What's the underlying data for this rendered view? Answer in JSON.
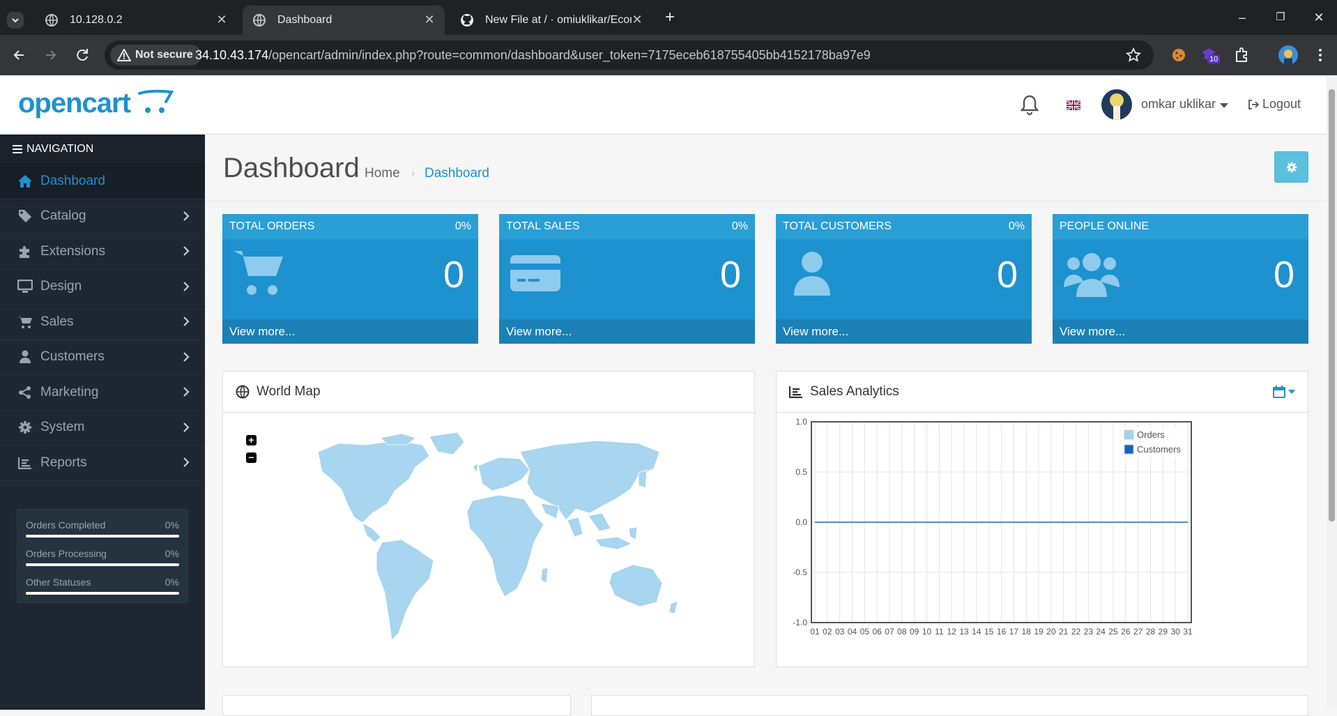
{
  "browser": {
    "tabs": [
      {
        "title": "10.128.0.2"
      },
      {
        "title": "Dashboard"
      },
      {
        "title": "New File at / · omiuklikar/Ecom"
      }
    ],
    "not_secure_label": "Not secure",
    "url_host": "34.10.43.174",
    "url_rest": "/opencart/admin/index.php?route=common/dashboard&user_token=7175eceb618755405bb4152178ba97e9",
    "extension_badge": "10"
  },
  "header": {
    "logo_text": "opencart",
    "username": "omkar uklikar",
    "logout_label": "Logout"
  },
  "sidebar": {
    "heading": "NAVIGATION",
    "items": [
      {
        "label": "Dashboard",
        "icon": "home-icon"
      },
      {
        "label": "Catalog",
        "icon": "tag-icon"
      },
      {
        "label": "Extensions",
        "icon": "puzzle-icon"
      },
      {
        "label": "Design",
        "icon": "monitor-icon"
      },
      {
        "label": "Sales",
        "icon": "cart-icon"
      },
      {
        "label": "Customers",
        "icon": "user-icon"
      },
      {
        "label": "Marketing",
        "icon": "share-icon"
      },
      {
        "label": "System",
        "icon": "gear-icon"
      },
      {
        "label": "Reports",
        "icon": "bar-chart-icon"
      }
    ],
    "stats": [
      {
        "label": "Orders Completed",
        "value": "0%",
        "fraction": 0
      },
      {
        "label": "Orders Processing",
        "value": "0%",
        "fraction": 0
      },
      {
        "label": "Other Statuses",
        "value": "0%",
        "fraction": 0
      }
    ]
  },
  "page": {
    "title": "Dashboard",
    "breadcrumb": [
      "Home",
      "Dashboard"
    ]
  },
  "tiles": [
    {
      "title": "TOTAL ORDERS",
      "percent": "0%",
      "value": "0",
      "more": "View more...",
      "icon": "cart-icon"
    },
    {
      "title": "TOTAL SALES",
      "percent": "0%",
      "value": "0",
      "more": "View more...",
      "icon": "credit-card-icon"
    },
    {
      "title": "TOTAL CUSTOMERS",
      "percent": "0%",
      "value": "0",
      "more": "View more...",
      "icon": "user-icon"
    },
    {
      "title": "PEOPLE ONLINE",
      "percent": "",
      "value": "0",
      "more": "View more...",
      "icon": "users-icon"
    }
  ],
  "world_map": {
    "title": "World Map",
    "zoom_in": "+",
    "zoom_out": "−"
  },
  "sales_analytics": {
    "title": "Sales Analytics"
  },
  "colors": {
    "accent": "#1e91cf",
    "sidebar": "#1e2732",
    "tile": "#1e91cf",
    "settings": "#5bc0de"
  },
  "chart_data": {
    "type": "line",
    "title": "",
    "x": [
      "01",
      "02",
      "03",
      "04",
      "05",
      "06",
      "07",
      "08",
      "09",
      "10",
      "11",
      "12",
      "13",
      "14",
      "15",
      "16",
      "17",
      "18",
      "19",
      "20",
      "21",
      "22",
      "23",
      "24",
      "25",
      "26",
      "27",
      "28",
      "29",
      "30",
      "31"
    ],
    "series": [
      {
        "name": "Orders",
        "color": "#9fd3f2",
        "values": [
          0,
          0,
          0,
          0,
          0,
          0,
          0,
          0,
          0,
          0,
          0,
          0,
          0,
          0,
          0,
          0,
          0,
          0,
          0,
          0,
          0,
          0,
          0,
          0,
          0,
          0,
          0,
          0,
          0,
          0,
          0
        ]
      },
      {
        "name": "Customers",
        "color": "#1065c4",
        "values": [
          0,
          0,
          0,
          0,
          0,
          0,
          0,
          0,
          0,
          0,
          0,
          0,
          0,
          0,
          0,
          0,
          0,
          0,
          0,
          0,
          0,
          0,
          0,
          0,
          0,
          0,
          0,
          0,
          0,
          0,
          0
        ]
      }
    ],
    "ylim": [
      -1.0,
      1.0
    ],
    "yticks": [
      "1.0",
      "0.5",
      "0.0",
      "-0.5",
      "-1.0"
    ],
    "grid": true,
    "legend": "top-right"
  }
}
